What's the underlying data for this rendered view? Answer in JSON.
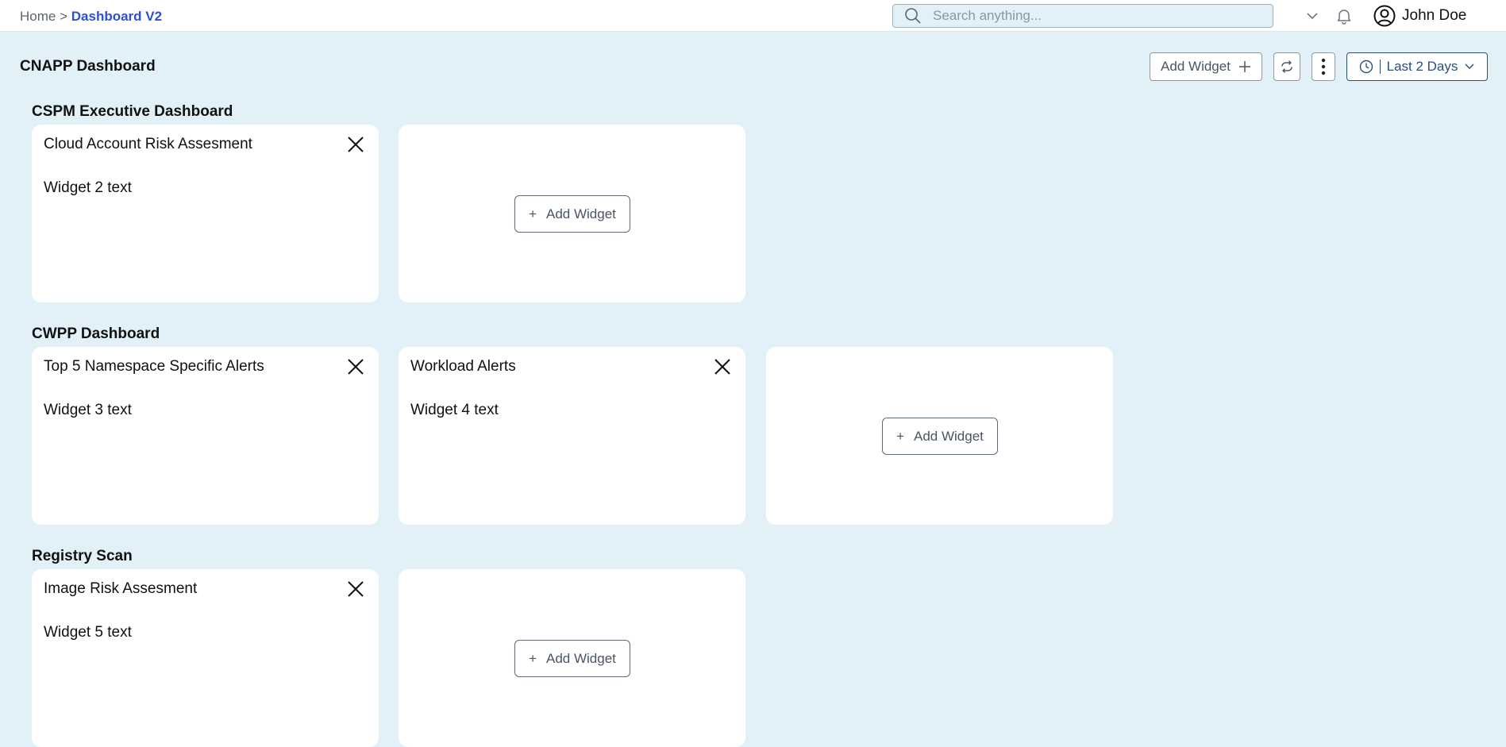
{
  "breadcrumb": {
    "home": "Home",
    "separator": ">",
    "current": "Dashboard V2"
  },
  "search": {
    "placeholder": "Search anything..."
  },
  "user": {
    "name": "John Doe"
  },
  "page": {
    "title": "CNAPP Dashboard"
  },
  "toolbar": {
    "add_widget_label": "Add Widget",
    "time_range_label": "Last 2 Days"
  },
  "sections": [
    {
      "title": "CSPM Executive Dashboard",
      "widgets": [
        {
          "title": "Cloud Account Risk Assesment",
          "text": "Widget 2 text"
        }
      ],
      "add_label": "Add Widget"
    },
    {
      "title": "CWPP Dashboard",
      "widgets": [
        {
          "title": "Top 5 Namespace Specific Alerts",
          "text": "Widget 3 text"
        },
        {
          "title": "Workload Alerts",
          "text": "Widget 4 text"
        }
      ],
      "add_label": "Add Widget"
    },
    {
      "title": "Registry Scan",
      "widgets": [
        {
          "title": "Image Risk Assesment",
          "text": "Widget 5 text"
        }
      ],
      "add_label": "Add Widget"
    }
  ],
  "icons": {
    "search": "search-icon",
    "chevron": "chevron-down-icon",
    "bell": "bell-icon",
    "user": "user-circle-icon",
    "plus": "plus-icon",
    "refresh": "refresh-icon",
    "more": "more-vertical-icon",
    "clock": "clock-icon",
    "close": "close-icon"
  },
  "colors": {
    "background": "#e2f1f8",
    "accent": "#2b52d6",
    "range_border": "#2e4f7a"
  }
}
